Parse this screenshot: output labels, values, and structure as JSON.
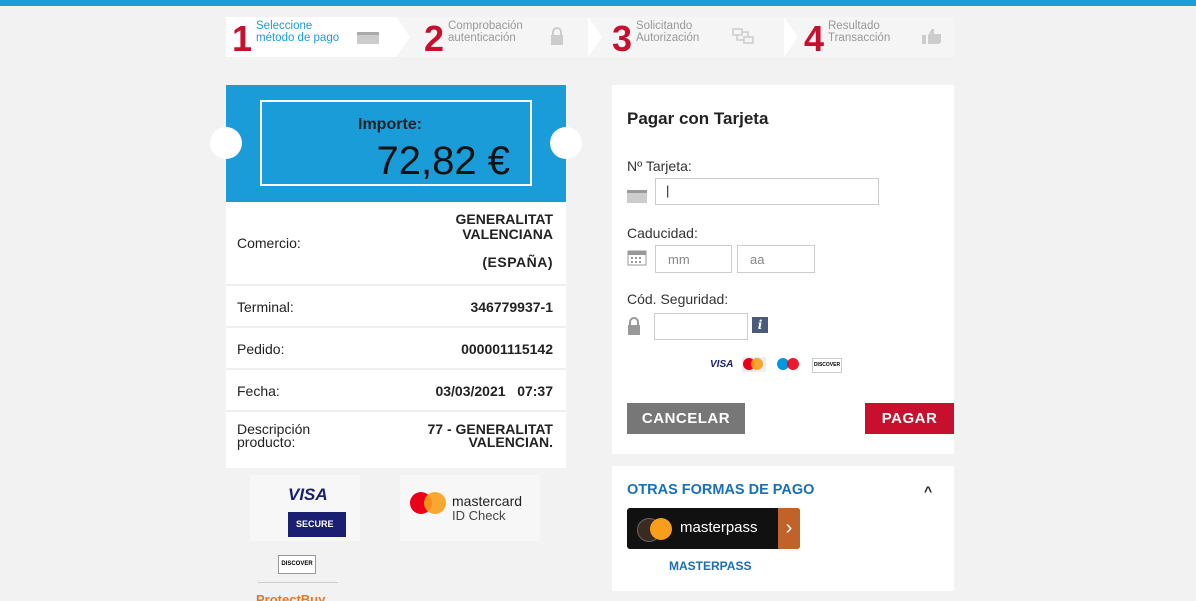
{
  "steps": [
    {
      "num": "1",
      "line1": "Seleccione",
      "line2": "método de pago"
    },
    {
      "num": "2",
      "line1": "Comprobación",
      "line2": "autenticación"
    },
    {
      "num": "3",
      "line1": "Solicitando",
      "line2": "Autorización"
    },
    {
      "num": "4",
      "line1": "Resultado",
      "line2": "Transacción"
    }
  ],
  "amount": {
    "label": "Importe:",
    "value": "72,82 €"
  },
  "details": {
    "comercio_label": "Comercio:",
    "comercio_value_1": "GENERALITAT",
    "comercio_value_2": "VALENCIANA",
    "comercio_value_3": "(ESPAÑA)",
    "terminal_label": "Terminal:",
    "terminal_value": "346779937-1",
    "pedido_label": "Pedido:",
    "pedido_value": "000001115142",
    "fecha_label": "Fecha:",
    "fecha_value": "03/03/2021   07:37",
    "desc_label_1": "Descripción",
    "desc_label_2": "producto:",
    "desc_value_1": "77 - GENERALITAT",
    "desc_value_2": "VALENCIAN."
  },
  "brands": {
    "visa": "VISA",
    "visa_secure": "SECURE",
    "mastercard": "mastercard",
    "mastercard_sub": "ID Check",
    "discover": "DISCOVER",
    "protectbuy": "ProtectBuy"
  },
  "form": {
    "title": "Pagar con Tarjeta",
    "card_label": "Nº Tarjeta:",
    "card_value": "|",
    "expiry_label": "Caducidad:",
    "month_placeholder": "mm",
    "year_placeholder": "aa",
    "cvv_label": "Cód. Seguridad:",
    "cvv_value": "",
    "info_icon": "i",
    "card_logos": {
      "visa": "VISA",
      "maestro": "Maestro",
      "discover": "DISCOVER"
    },
    "cancel": "CANCELAR",
    "pay": "PAGAR"
  },
  "other": {
    "title": "OTRAS FORMAS DE PAGO",
    "toggle": "^",
    "masterpass_button": "masterpass",
    "masterpass_label": "MASTERPASS"
  },
  "colors": {
    "accent": "#1a9cd8",
    "brand_red": "#c8102e",
    "link_blue": "#1a6fb5"
  }
}
